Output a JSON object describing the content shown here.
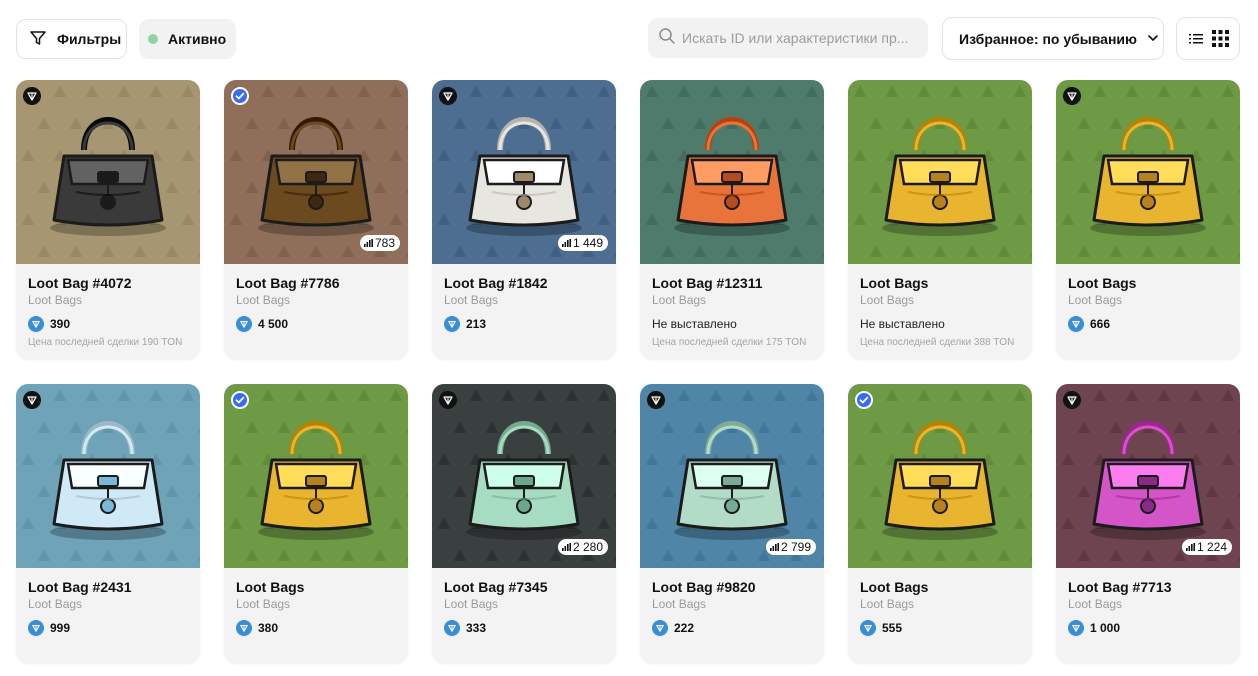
{
  "toolbar": {
    "filters_label": "Фильтры",
    "active_label": "Активно",
    "search_placeholder": "Искать ID или характеристики пр...",
    "sort_label": "Избранное: по убыванию"
  },
  "colors": {
    "green_dot": "#8fd4a2",
    "ton_blue": "#3a8ed8",
    "verified_blue": "#3a6cf0"
  },
  "cards": [
    {
      "title": "Loot Bag #4072",
      "collection": "Loot Bags",
      "price": "390",
      "last_deal": "Цена последней сделки 190 TON",
      "views": "",
      "badge": "ton-dark",
      "bg": "#a69772",
      "bag": "#3a3a3a",
      "accent": "#1a1a1a"
    },
    {
      "title": "Loot Bag #7786",
      "collection": "Loot Bags",
      "price": "4 500",
      "last_deal": "",
      "views": "783",
      "badge": "verified",
      "bg": "#8f6f5a",
      "bag": "#6b4a20",
      "accent": "#3d2810"
    },
    {
      "title": "Loot Bag #1842",
      "collection": "Loot Bags",
      "price": "213",
      "last_deal": "",
      "views": "1 449",
      "badge": "ton-dark",
      "bg": "#4d6e90",
      "bag": "#e8e6e0",
      "accent": "#a0896a"
    },
    {
      "title": "Loot Bag #12311",
      "collection": "Loot Bags",
      "price": "",
      "not_listed": "Не выставлено",
      "last_deal": "Цена последней сделки 175 TON",
      "views": "",
      "badge": "",
      "bg": "#4e7b6c",
      "bag": "#e8743c",
      "accent": "#b44c20"
    },
    {
      "title": "Loot Bags",
      "collection": "Loot Bags",
      "price": "",
      "not_listed": "Не выставлено",
      "last_deal": "Цена последней сделки 388 TON",
      "views": "",
      "badge": "",
      "bg": "#6f9a45",
      "bag": "#e9b530",
      "accent": "#b8821a"
    },
    {
      "title": "Loot Bags",
      "collection": "Loot Bags",
      "price": "666",
      "last_deal": "",
      "views": "",
      "badge": "ton-dark",
      "bg": "#6f9a45",
      "bag": "#e9b530",
      "accent": "#b8821a"
    },
    {
      "title": "Loot Bag #2431",
      "collection": "Loot Bags",
      "price": "999",
      "last_deal": "",
      "views": "",
      "badge": "ton-dark",
      "bg": "#6fa3b8",
      "bag": "#cfeaf6",
      "accent": "#78b8d8"
    },
    {
      "title": "Loot Bags",
      "collection": "Loot Bags",
      "price": "380",
      "last_deal": "",
      "views": "",
      "badge": "verified",
      "bg": "#6f9a45",
      "bag": "#e9b530",
      "accent": "#b8821a"
    },
    {
      "title": "Loot Bag #7345",
      "collection": "Loot Bags",
      "price": "333",
      "last_deal": "",
      "views": "2 280",
      "badge": "ton-dark",
      "bg": "#3a3f40",
      "bag": "#a6dcc2",
      "accent": "#6aa88c"
    },
    {
      "title": "Loot Bag #9820",
      "collection": "Loot Bags",
      "price": "222",
      "last_deal": "",
      "views": "2 799",
      "badge": "ton-dark",
      "bg": "#4f86a8",
      "bag": "#b3dcc8",
      "accent": "#78ab95"
    },
    {
      "title": "Loot Bags",
      "collection": "Loot Bags",
      "price": "555",
      "last_deal": "",
      "views": "",
      "badge": "verified",
      "bg": "#6f9a45",
      "bag": "#e9b530",
      "accent": "#b8821a"
    },
    {
      "title": "Loot Bag #7713",
      "collection": "Loot Bags",
      "price": "1 000",
      "last_deal": "",
      "views": "1 224",
      "badge": "ton-dark",
      "bg": "#6e4450",
      "bag": "#d455c8",
      "accent": "#8a2a88"
    }
  ]
}
